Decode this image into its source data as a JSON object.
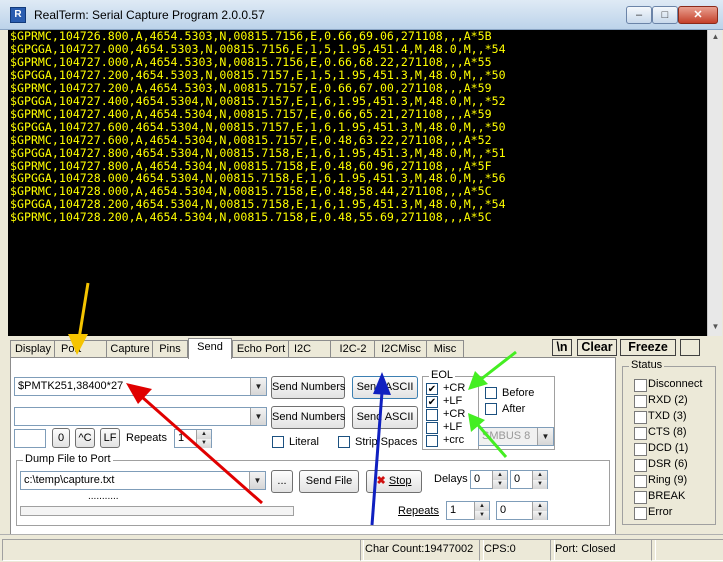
{
  "window": {
    "title": "RealTerm: Serial Capture Program 2.0.0.57",
    "minimize_label": "–",
    "maximize_label": "□",
    "close_label": "✕"
  },
  "terminal": {
    "text_color": "#ffff00",
    "background": "#000000",
    "lines": [
      "$GPRMC,104726.800,A,4654.5303,N,00815.7156,E,0.66,69.06,271108,,,A*5B",
      "$GPGGA,104727.000,4654.5303,N,00815.7156,E,1,5,1.95,451.4,M,48.0,M,,*54",
      "$GPRMC,104727.000,A,4654.5303,N,00815.7156,E,0.66,68.22,271108,,,A*55",
      "$GPGGA,104727.200,4654.5303,N,00815.7157,E,1,5,1.95,451.3,M,48.0,M,,*50",
      "$GPRMC,104727.200,A,4654.5303,N,00815.7157,E,0.66,67.00,271108,,,A*59",
      "$GPGGA,104727.400,4654.5304,N,00815.7157,E,1,6,1.95,451.3,M,48.0,M,,*52",
      "$GPRMC,104727.400,A,4654.5304,N,00815.7157,E,0.66,65.21,271108,,,A*59",
      "$GPGGA,104727.600,4654.5304,N,00815.7157,E,1,6,1.95,451.3,M,48.0,M,,*50",
      "$GPRMC,104727.600,A,4654.5304,N,00815.7157,E,0.48,63.22,271108,,,A*52",
      "$GPGGA,104727.800,4654.5304,N,00815.7158,E,1,6,1.95,451.3,M,48.0,M,,*51",
      "$GPRMC,104727.800,A,4654.5304,N,00815.7158,E,0.48,60.96,271108,,,A*5F",
      "$GPGGA,104728.000,4654.5304,N,00815.7158,E,1,6,1.95,451.3,M,48.0,M,,*56",
      "$GPRMC,104728.000,A,4654.5304,N,00815.7158,E,0.48,58.44,271108,,,A*5C",
      "$GPGGA,104728.200,4654.5304,N,00815.7158,E,1,6,1.95,451.3,M,48.0,M,,*54",
      "$GPRMC,104728.200,A,4654.5304,N,00815.7158,E,0.48,55.69,271108,,,A*5C"
    ]
  },
  "tabs": [
    {
      "label": "Display"
    },
    {
      "label": "Port"
    },
    {
      "label": "Capture"
    },
    {
      "label": "Pins"
    },
    {
      "label": "Send"
    },
    {
      "label": "Echo Port"
    },
    {
      "label": "I2C"
    },
    {
      "label": "I2C-2"
    },
    {
      "label": "I2CMisc"
    },
    {
      "label": "Misc"
    }
  ],
  "toolbar": {
    "newline_label": "\\n",
    "clear_label": "Clear",
    "freeze_label": "Freeze",
    "extra_label": ""
  },
  "send": {
    "line1_value": "$PMTK251,38400*27",
    "line2_value": "",
    "send_numbers_label": "Send Numbers",
    "send_ascii_label": "Send ASCII",
    "small_value": "",
    "zero_label": "0",
    "ctrl_c_label": "^C",
    "lf_label": "LF",
    "repeats_label": "Repeats",
    "repeats_value": "1",
    "literal_label": "Literal",
    "strip_spaces_label": "Strip Spaces"
  },
  "eol": {
    "title": "EOL",
    "items1": [
      {
        "label": "+CR",
        "checked": true
      },
      {
        "label": "+LF",
        "checked": true
      }
    ],
    "items2": [
      {
        "label": "+CR",
        "checked": false
      },
      {
        "label": "+LF",
        "checked": false
      },
      {
        "label": "+crc",
        "checked": false
      }
    ],
    "mark": "✔",
    "before_label": "Before",
    "after_label": "After",
    "smbus_value": "SMBUS 8"
  },
  "dump": {
    "title": "Dump File to Port",
    "file_value": "c:\\temp\\capture.txt",
    "browse_label": "...",
    "send_file_label": "Send File",
    "stop_label": "Stop",
    "stop_icon": "✖",
    "delays_label": "Delays",
    "delay1_value": "0",
    "delay2_value": "0",
    "repeats_label": "Repeats",
    "repeats1_value": "1",
    "repeats2_value": "0",
    "progress_text": "..........."
  },
  "status": {
    "title": "Status",
    "items": [
      {
        "label": "Disconnect"
      },
      {
        "label": "RXD (2)"
      },
      {
        "label": "TXD (3)"
      },
      {
        "label": "CTS (8)"
      },
      {
        "label": "DCD (1)"
      },
      {
        "label": "DSR (6)"
      },
      {
        "label": "Ring (9)"
      },
      {
        "label": "BREAK"
      },
      {
        "label": "Error"
      }
    ]
  },
  "statusbar": {
    "char_count": "Char Count:19477002",
    "cps": "CPS:0",
    "port": "Port: Closed"
  },
  "annotation_colors": {
    "yellow": "#f5c400",
    "red": "#e00000",
    "blue": "#1020c0",
    "green": "#44ee22"
  }
}
